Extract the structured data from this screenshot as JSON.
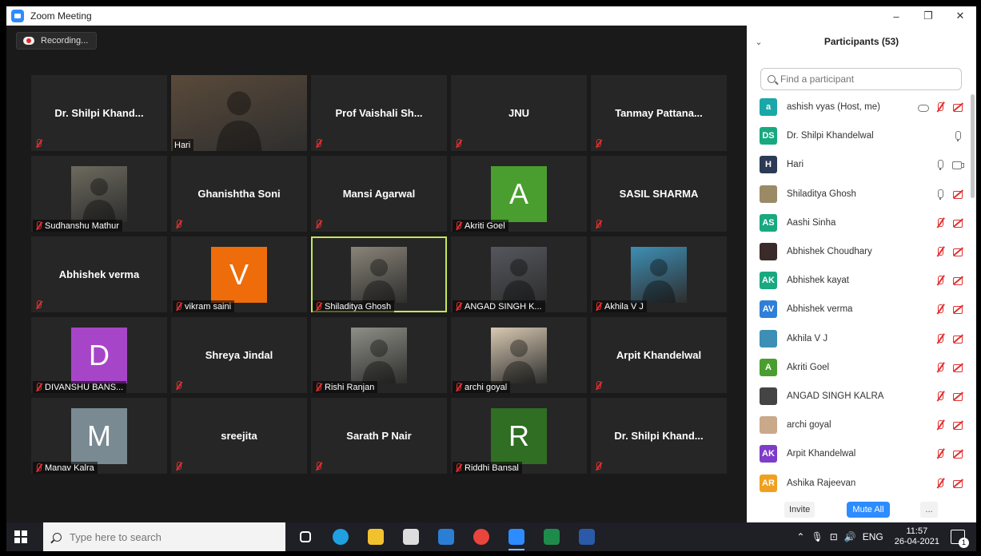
{
  "window": {
    "title": "Zoom Meeting",
    "minimize": "–",
    "restore": "❐",
    "close": "✕"
  },
  "recording": {
    "label": "Recording..."
  },
  "tiles": [
    {
      "kind": "name",
      "display": "Dr. Shilpi Khand...",
      "label": ""
    },
    {
      "kind": "video",
      "display": "",
      "label": "Hari",
      "tone": "#5a4a3a"
    },
    {
      "kind": "name",
      "display": "Prof Vaishali Sh...",
      "label": ""
    },
    {
      "kind": "name",
      "display": "JNU",
      "label": ""
    },
    {
      "kind": "name",
      "display": "Tanmay Pattana...",
      "label": ""
    },
    {
      "kind": "photo",
      "display": "",
      "label": "Sudhanshu Mathur",
      "tone": "#6d6a5e"
    },
    {
      "kind": "name",
      "display": "Ghanishtha Soni",
      "label": ""
    },
    {
      "kind": "name",
      "display": "Mansi Agarwal",
      "label": ""
    },
    {
      "kind": "letter",
      "display": "A",
      "label": "Akriti Goel",
      "color": "#4a9e2f"
    },
    {
      "kind": "name",
      "display": "SASIL SHARMA",
      "label": ""
    },
    {
      "kind": "name",
      "display": "Abhishek verma",
      "label": ""
    },
    {
      "kind": "letter",
      "display": "V",
      "label": "vikram saini",
      "color": "#ee6c0a"
    },
    {
      "kind": "photo",
      "display": "",
      "label": "Shiladitya Ghosh",
      "tone": "#8a8478",
      "active": true
    },
    {
      "kind": "photo",
      "display": "",
      "label": "ANGAD SINGH K...",
      "tone": "#55575e"
    },
    {
      "kind": "photo",
      "display": "",
      "label": "Akhila V J",
      "tone": "#3d8fb5"
    },
    {
      "kind": "letter",
      "display": "D",
      "label": "DIVANSHU BANS...",
      "color": "#a745c9"
    },
    {
      "kind": "name",
      "display": "Shreya Jindal",
      "label": ""
    },
    {
      "kind": "photo",
      "display": "",
      "label": "Rishi Ranjan",
      "tone": "#8e8f86"
    },
    {
      "kind": "photo",
      "display": "",
      "label": "archi goyal",
      "tone": "#d8c9b2"
    },
    {
      "kind": "name",
      "display": "Arpit Khandelwal",
      "label": ""
    },
    {
      "kind": "letter",
      "display": "M",
      "label": "Manav Kalra",
      "color": "#7a8a93"
    },
    {
      "kind": "name",
      "display": "sreejita",
      "label": ""
    },
    {
      "kind": "name",
      "display": "Sarath P Nair",
      "label": ""
    },
    {
      "kind": "letter",
      "display": "R",
      "label": "Riddhi Bansal",
      "color": "#2f6e23"
    },
    {
      "kind": "name",
      "display": "Dr. Shilpi Khand...",
      "label": ""
    }
  ],
  "panel": {
    "title": "Participants (53)",
    "search_placeholder": "Find a participant",
    "participants": [
      {
        "initials": "a",
        "name": "ashish vyas (Host, me)",
        "color": "#19a7a7",
        "icons": [
          "cloud",
          "mic-off",
          "vid-off"
        ]
      },
      {
        "initials": "DS",
        "name": "Dr. Shilpi Khandelwal",
        "color": "#19a880",
        "icons": [
          "mic"
        ]
      },
      {
        "initials": "H",
        "name": "Hari",
        "color": "#2b3a55",
        "icons": [
          "mic",
          "vid"
        ]
      },
      {
        "initials": "",
        "name": "Shiladitya Ghosh",
        "color": "#9a8a66",
        "icons": [
          "mic",
          "vid-off"
        ]
      },
      {
        "initials": "AS",
        "name": "Aashi Sinha",
        "color": "#19a880",
        "icons": [
          "mic-off",
          "vid-off"
        ]
      },
      {
        "initials": "",
        "name": "Abhishek Choudhary",
        "color": "#3a2a2a",
        "icons": [
          "mic-off",
          "vid-off"
        ]
      },
      {
        "initials": "AK",
        "name": "Abhishek kayat",
        "color": "#19a880",
        "icons": [
          "mic-off",
          "vid-off"
        ]
      },
      {
        "initials": "AV",
        "name": "Abhishek verma",
        "color": "#2f7fd8",
        "icons": [
          "mic-off",
          "vid-off"
        ]
      },
      {
        "initials": "",
        "name": "Akhila V J",
        "color": "#3d8fb5",
        "icons": [
          "mic-off",
          "vid-off"
        ]
      },
      {
        "initials": "A",
        "name": "Akriti Goel",
        "color": "#4a9e2f",
        "icons": [
          "mic-off",
          "vid-off"
        ]
      },
      {
        "initials": "",
        "name": "ANGAD SINGH KALRA",
        "color": "#444444",
        "icons": [
          "mic-off",
          "vid-off"
        ]
      },
      {
        "initials": "",
        "name": "archi goyal",
        "color": "#c9a98a",
        "icons": [
          "mic-off",
          "vid-off"
        ]
      },
      {
        "initials": "AK",
        "name": "Arpit Khandelwal",
        "color": "#7d3cc9",
        "icons": [
          "mic-off",
          "vid-off"
        ]
      },
      {
        "initials": "AR",
        "name": "Ashika Rajeevan",
        "color": "#f0a020",
        "icons": [
          "mic-off",
          "vid-off"
        ]
      }
    ],
    "invite_label": "Invite",
    "mute_all_label": "Mute All",
    "more_label": "..."
  },
  "taskbar": {
    "search_placeholder": "Type here to search",
    "apps": [
      "task-view",
      "edge",
      "file-explorer",
      "store",
      "mail",
      "chrome",
      "zoom",
      "excel",
      "word"
    ],
    "tray_lang": "ENG",
    "time": "11:57",
    "date": "26-04-2021",
    "notifications": "1"
  }
}
